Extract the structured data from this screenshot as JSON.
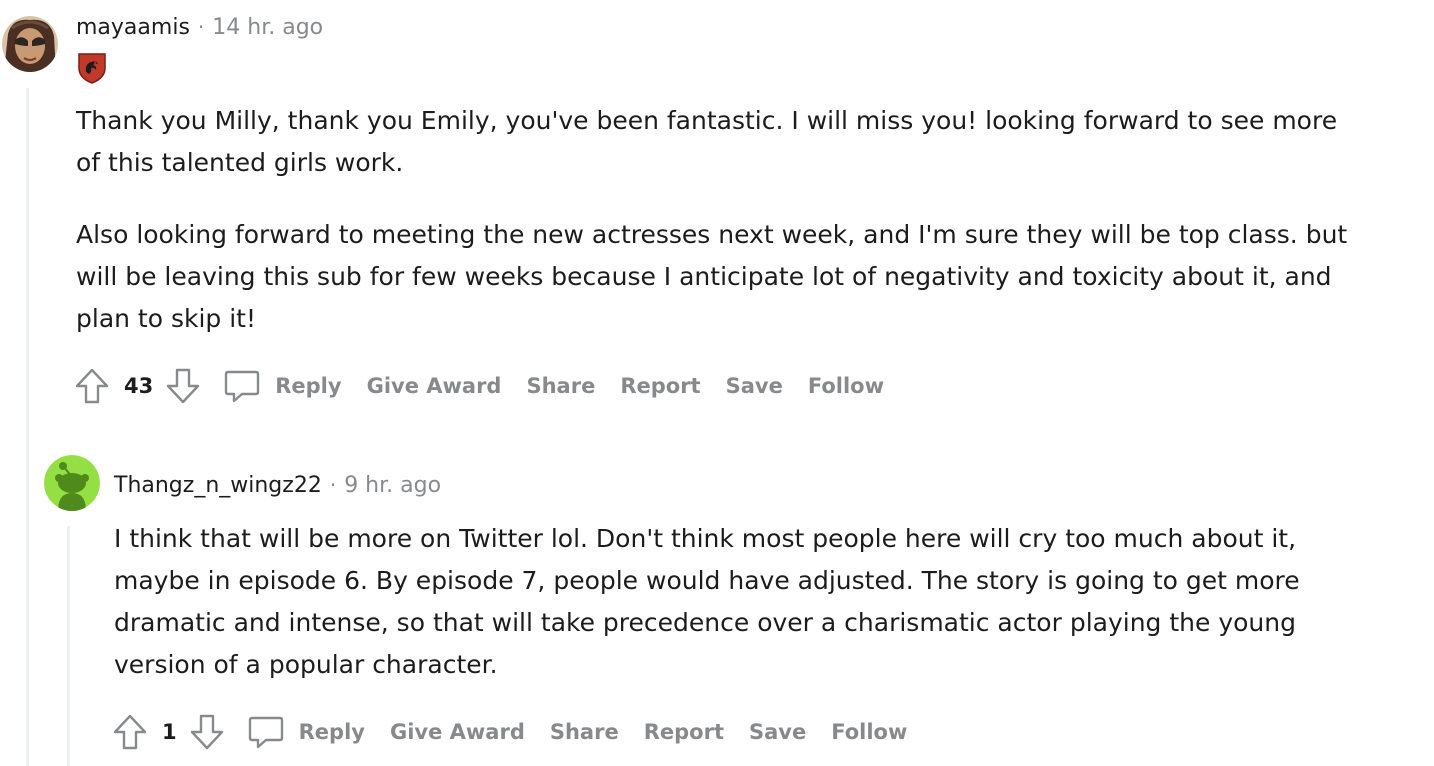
{
  "comments": [
    {
      "username": "mayaamis",
      "time": "14 hr. ago",
      "paragraphs": [
        "Thank you Milly, thank you Emily, you've been fantastic. I will miss you! looking forward to see more of this talented girls work.",
        "Also looking forward to meeting the new actresses next week, and I'm sure they will be top class. but will be leaving this sub for few weeks because I anticipate lot of negativity and toxicity about it, and plan to skip it!"
      ],
      "score": "43",
      "actions": {
        "reply": "Reply",
        "give_award": "Give Award",
        "share": "Share",
        "report": "Report",
        "save": "Save",
        "follow": "Follow"
      }
    },
    {
      "username": "Thangz_n_wingz22",
      "time": "9 hr. ago",
      "paragraphs": [
        "I think that will be more on Twitter lol. Don't think most people here will cry too much about it, maybe in episode 6. By episode 7, people would have adjusted. The story is going to get more dramatic and intense, so that will take precedence over a charismatic actor playing the young version of a popular character."
      ],
      "score": "1",
      "actions": {
        "reply": "Reply",
        "give_award": "Give Award",
        "share": "Share",
        "report": "Report",
        "save": "Save",
        "follow": "Follow"
      }
    }
  ],
  "icons": {
    "upvote": "upvote-arrow-icon",
    "downvote": "downvote-arrow-icon",
    "reply": "speech-bubble-icon",
    "flair": "dragon-crest-shield-icon",
    "avatar_default": "reddit-snoo-icon"
  },
  "colors": {
    "muted_text": "#878a8c",
    "thread_line": "#edeff1",
    "snoo_bg": "#94e044",
    "flair_red": "#c0392b"
  }
}
